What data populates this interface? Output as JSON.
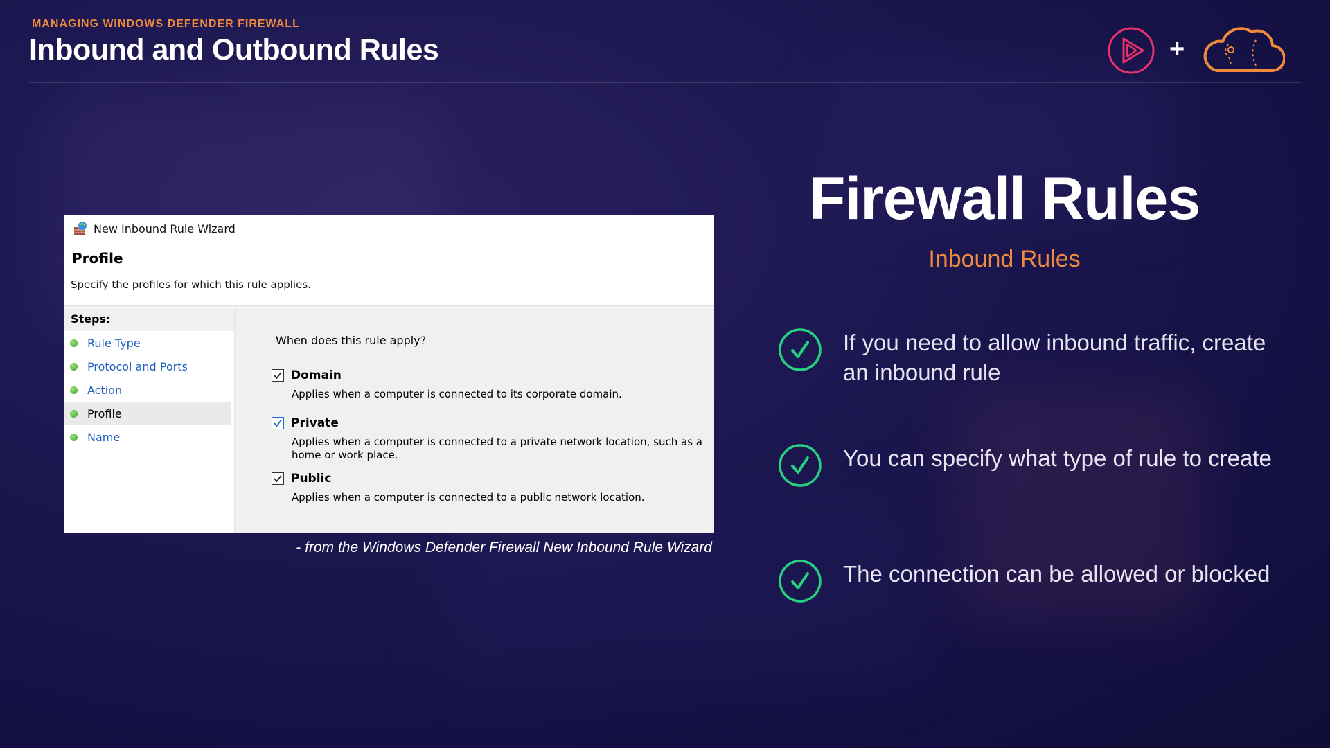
{
  "header": {
    "eyebrow": "MANAGING WINDOWS DEFENDER FIREWALL",
    "title": "Inbound and Outbound Rules",
    "plus": "+",
    "logos": [
      "play-logo-icon",
      "cloud-logo-icon"
    ]
  },
  "wizard": {
    "window_title": "New Inbound Rule Wizard",
    "header": "Profile",
    "subtitle": "Specify the profiles for which this rule applies.",
    "steps_heading": "Steps:",
    "steps": [
      {
        "label": "Rule Type"
      },
      {
        "label": "Protocol and Ports"
      },
      {
        "label": "Action"
      },
      {
        "label": "Profile",
        "current": true
      },
      {
        "label": "Name"
      }
    ],
    "question": "When does this rule apply?",
    "options": [
      {
        "label": "Domain",
        "checked": true,
        "desc": "Applies when a computer is connected to its corporate domain."
      },
      {
        "label": "Private",
        "checked": true,
        "desc": "Applies when a computer is connected to a private network location, such as a home or work place."
      },
      {
        "label": "Public",
        "checked": true,
        "desc": "Applies when a computer is connected to a public network location."
      }
    ]
  },
  "caption": "- from the Windows Defender Firewall New Inbound Rule Wizard",
  "right": {
    "title": "Firewall Rules",
    "subtitle": "Inbound Rules",
    "bullets": [
      "If you need to allow inbound traffic, create an inbound rule",
      "You can specify what type of rule to create",
      "The connection can be allowed or blocked"
    ]
  },
  "colors": {
    "accent_orange": "#f08a3c",
    "check_green": "#27d07f",
    "link_blue": "#1f5fbf",
    "logo_pink": "#e8326a"
  }
}
